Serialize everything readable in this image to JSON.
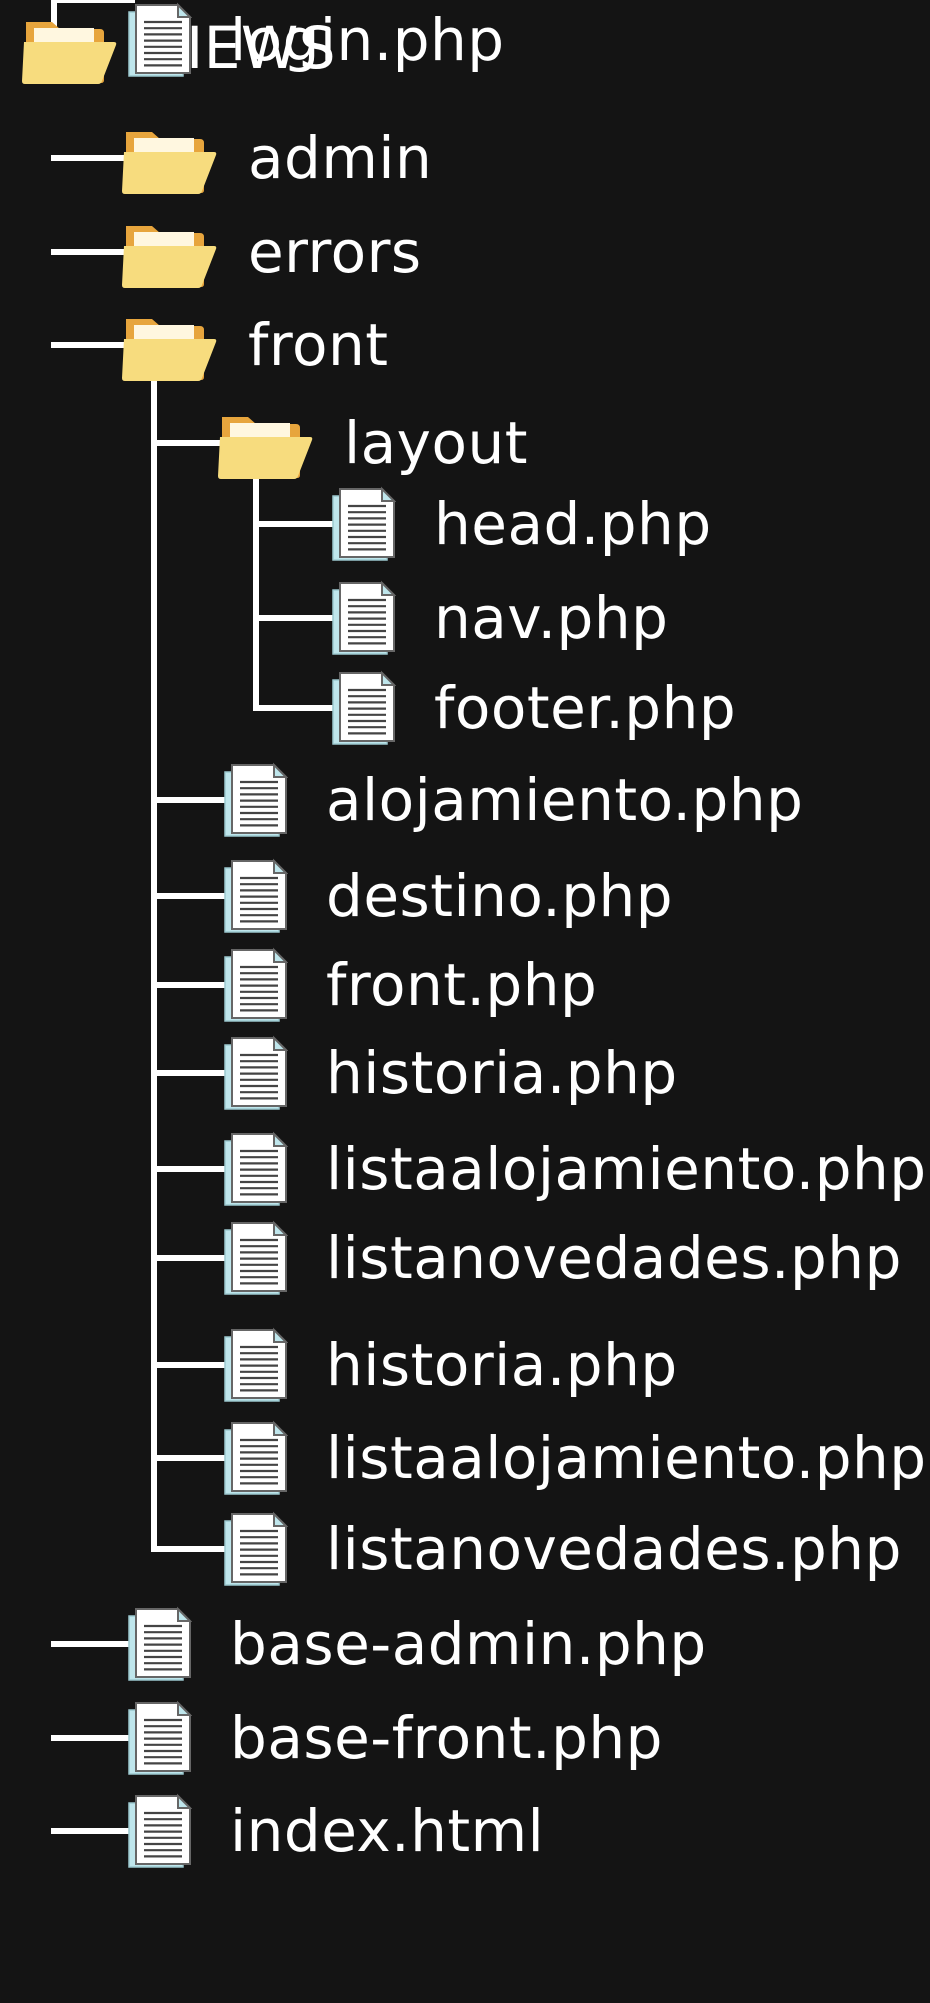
{
  "colors": {
    "background": "#141414",
    "text": "#ffffff",
    "connector": "#ffffff",
    "folder_front": "#f7dc7e",
    "folder_back": "#e7a53d",
    "file_paper": "#ffffff",
    "file_shadow": "#bfe6ec"
  },
  "root": {
    "name": "VIEWS",
    "type": "folder",
    "icon": "folder-icon"
  },
  "items": [
    {
      "name": "admin",
      "type": "folder",
      "depth": 1,
      "icon": "folder-icon"
    },
    {
      "name": "errors",
      "type": "folder",
      "depth": 1,
      "icon": "folder-icon"
    },
    {
      "name": "front",
      "type": "folder",
      "depth": 1,
      "icon": "folder-icon"
    },
    {
      "name": "layout",
      "type": "folder",
      "depth": 2,
      "icon": "folder-icon"
    },
    {
      "name": "head.php",
      "type": "file",
      "depth": 3,
      "icon": "file-icon"
    },
    {
      "name": "nav.php",
      "type": "file",
      "depth": 3,
      "icon": "file-icon"
    },
    {
      "name": "footer.php",
      "type": "file",
      "depth": 3,
      "icon": "file-icon"
    },
    {
      "name": "alojamiento.php",
      "type": "file",
      "depth": 2,
      "icon": "file-icon"
    },
    {
      "name": "destino.php",
      "type": "file",
      "depth": 2,
      "icon": "file-icon"
    },
    {
      "name": "front.php",
      "type": "file",
      "depth": 2,
      "icon": "file-icon"
    },
    {
      "name": "historia.php",
      "type": "file",
      "depth": 2,
      "icon": "file-icon"
    },
    {
      "name": "listaalojamiento.php",
      "type": "file",
      "depth": 2,
      "icon": "file-icon"
    },
    {
      "name": "listanovedades.php",
      "type": "file",
      "depth": 2,
      "icon": "file-icon"
    },
    {
      "name": "historia.php",
      "type": "file",
      "depth": 2,
      "icon": "file-icon"
    },
    {
      "name": "listaalojamiento.php",
      "type": "file",
      "depth": 2,
      "icon": "file-icon"
    },
    {
      "name": "listanovedades.php",
      "type": "file",
      "depth": 2,
      "icon": "file-icon"
    },
    {
      "name": "base-admin.php",
      "type": "file",
      "depth": 1,
      "icon": "file-icon"
    },
    {
      "name": "base-front.php",
      "type": "file",
      "depth": 1,
      "icon": "file-icon"
    },
    {
      "name": "index.html",
      "type": "file",
      "depth": 1,
      "icon": "file-icon"
    },
    {
      "name": "login.php",
      "type": "file",
      "depth": 1,
      "icon": "file-icon"
    }
  ]
}
